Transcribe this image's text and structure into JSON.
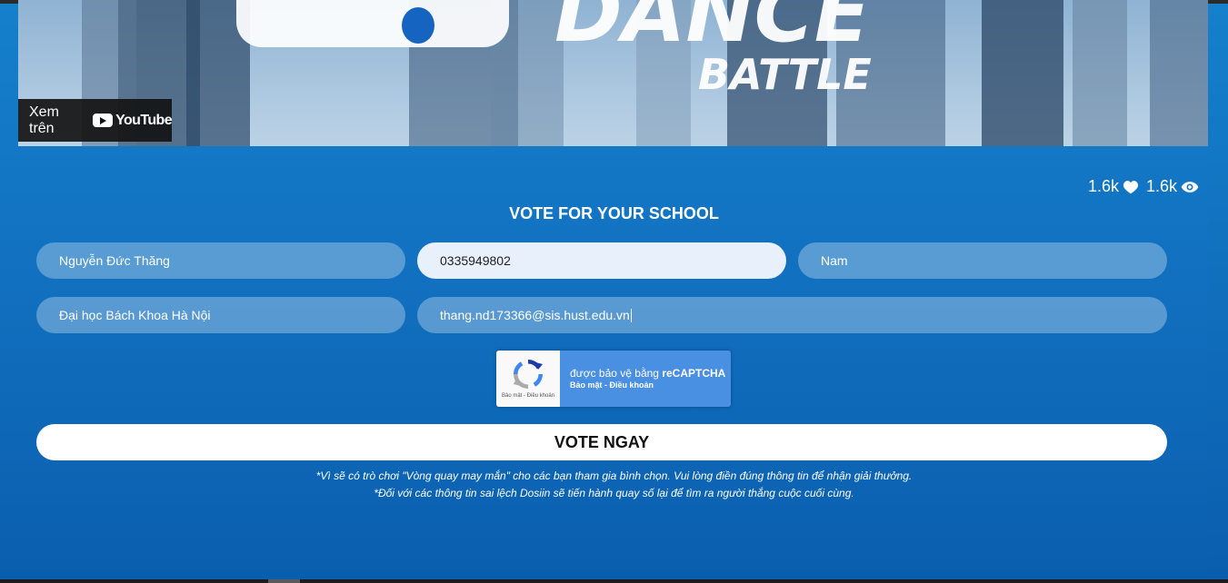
{
  "video": {
    "watch_on_label": "Xem trên",
    "youtube_label": "YouTube",
    "banner_word": "BATTLE"
  },
  "stats": {
    "likes": "1.6k",
    "views": "1.6k"
  },
  "form": {
    "title": "VOTE FOR YOUR SCHOOL",
    "name_value": "Nguyễn Đức Thăng",
    "phone_value": "0335949802",
    "gender_value": "Nam",
    "school_value": "Đại học Bách Khoa Hà Nội",
    "email_value": "thang.nd173366@sis.hust.edu.vn",
    "submit_label": "VOTE NGAY"
  },
  "recaptcha": {
    "protected_prefix": "được bảo vệ bằng ",
    "brand": "reCAPTCHA",
    "links": "Bảo mật - Điều khoản",
    "mini_links": "Bảo mật - Điều khoản"
  },
  "notes": {
    "line1": "*Vì sẽ có trò chơi \"Vòng quay may mắn\" cho các bạn tham gia bình chọn. Vui lòng điền đúng thông tin để nhận giải thưởng.",
    "line2": "*Đối với các thông tin sai lệch Dosiin sẽ tiến hành quay số lại để tìm ra người thắng cuộc cuối cùng."
  },
  "colors": {
    "background": "#1273c2",
    "field_background": "rgba(255,255,255,0.3)",
    "field_active": "#e8f0fc",
    "recaptcha_blue": "#4a90e2"
  }
}
